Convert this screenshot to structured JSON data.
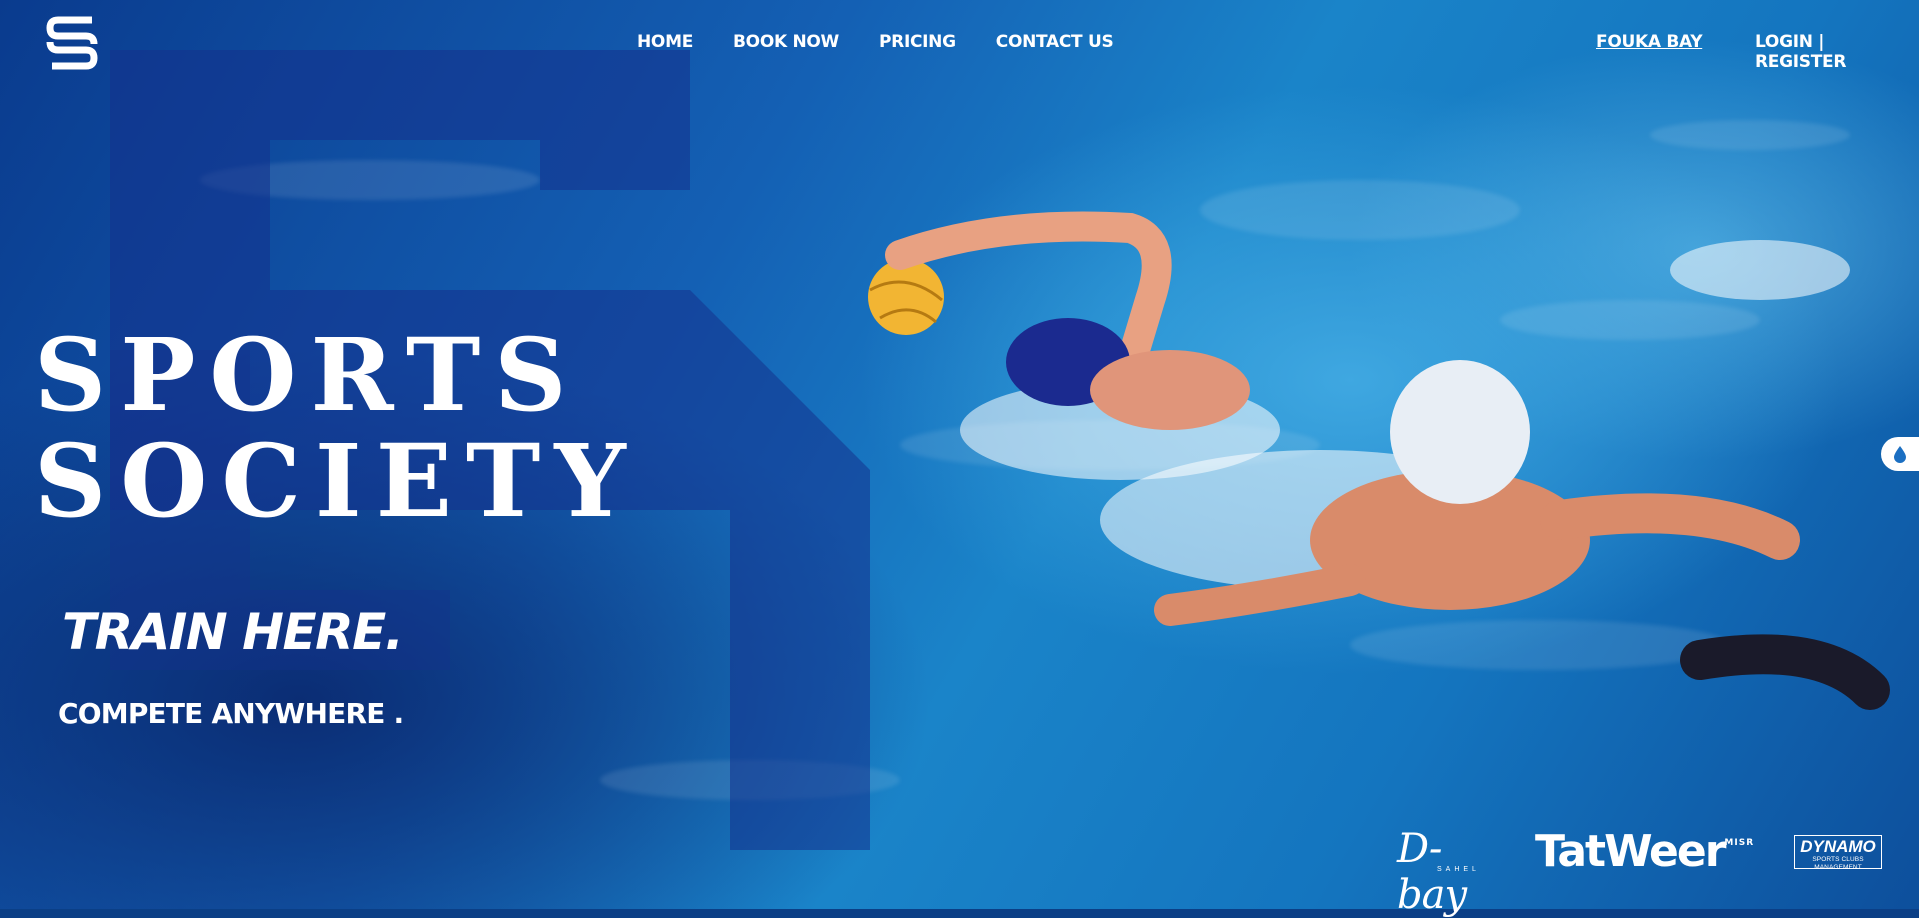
{
  "brand": {
    "logo_name": "ss-monogram-logo"
  },
  "nav": {
    "items": [
      {
        "label": "HOME"
      },
      {
        "label": "BOOK NOW"
      },
      {
        "label": "PRICING"
      },
      {
        "label": "CONTACT US"
      }
    ]
  },
  "location": {
    "label": "FOUKA BAY"
  },
  "auth": {
    "login": "LOGIN",
    "separator": " | ",
    "register": "REGISTER"
  },
  "hero": {
    "title_line1": "SPORTS",
    "title_line2": "SOCIETY",
    "tagline_primary": "TRAIN HERE.",
    "tagline_secondary": "COMPETE ANYWHERE ."
  },
  "sponsors": {
    "dbay": {
      "name": "D-bay",
      "sub": "SAHEL"
    },
    "tatweer": {
      "name": "TatWeer",
      "sub": "MISR"
    },
    "dynamo": {
      "name": "DYNAMO",
      "sub": "SPORTS CLUBS MANAGEMENT"
    }
  },
  "colors": {
    "water_dark": "#0b3f86",
    "water_light": "#1a84c9",
    "text": "#ffffff"
  },
  "side_widget": {
    "icon": "water-drop-icon"
  }
}
